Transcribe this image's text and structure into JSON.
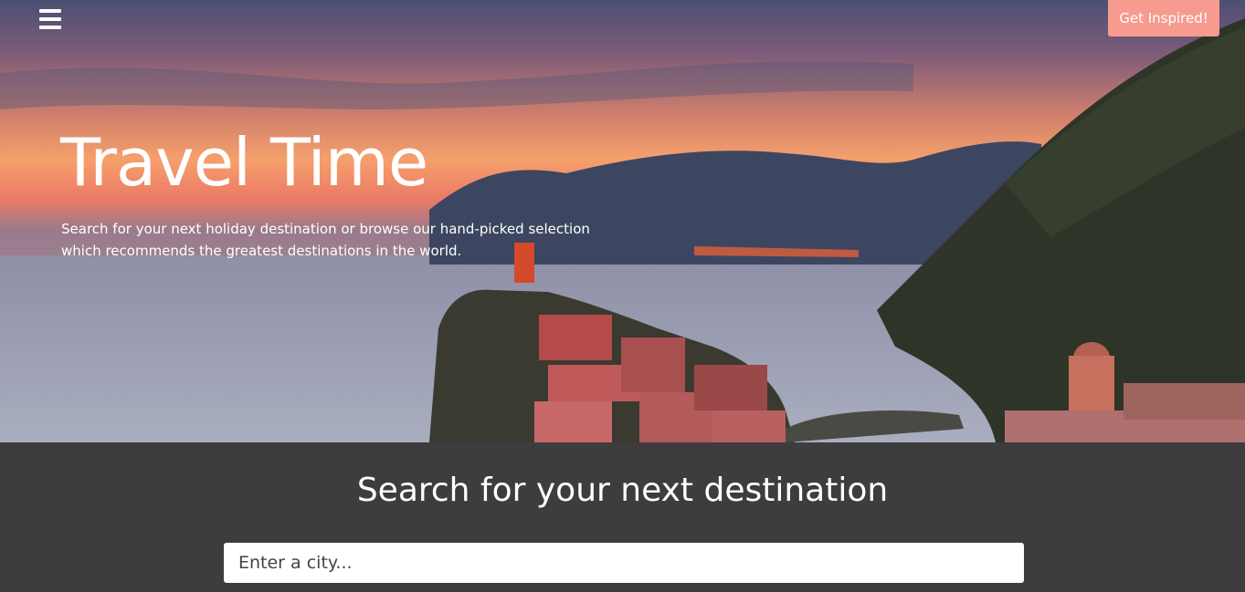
{
  "nav": {
    "menu_icon": "hamburger-menu-icon",
    "cta_label": "Get Inspired!"
  },
  "hero": {
    "title": "Travel Time",
    "subtitle_line1": "Search for your next holiday destination or browse our hand-picked selection",
    "subtitle_line2": "which recommends the greatest destinations in the world."
  },
  "search": {
    "heading": "Search for your next destination",
    "placeholder": "Enter a city...",
    "value": ""
  },
  "colors": {
    "cta_background": "#f79b8f",
    "search_section_background": "#3d3d3d",
    "text": "#ffffff"
  }
}
